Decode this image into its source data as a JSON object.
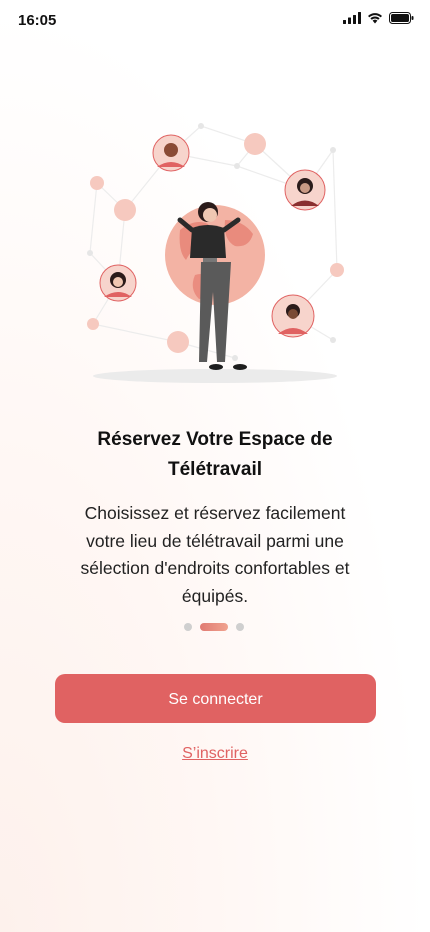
{
  "status_bar": {
    "time": "16:05",
    "icons": [
      "signal-icon",
      "wifi-icon",
      "battery-icon"
    ]
  },
  "onboarding": {
    "title_line1": "Réservez Votre Espace de",
    "title_line2": "Télétravail",
    "description_line1": "Choisissez et réservez facilement",
    "description_line2": "votre lieu de télétravail parmi une",
    "description_line3": "sélection d'endroits confortables et",
    "description_line4": "équipés.",
    "pagination": {
      "total": 3,
      "active": 2
    }
  },
  "actions": {
    "login_label": "Se connecter",
    "register_label": "S’inscrire"
  },
  "colors": {
    "accent": "#e06262",
    "accent_light": "#f0a38f",
    "dot_inactive": "#cfcfcf"
  }
}
